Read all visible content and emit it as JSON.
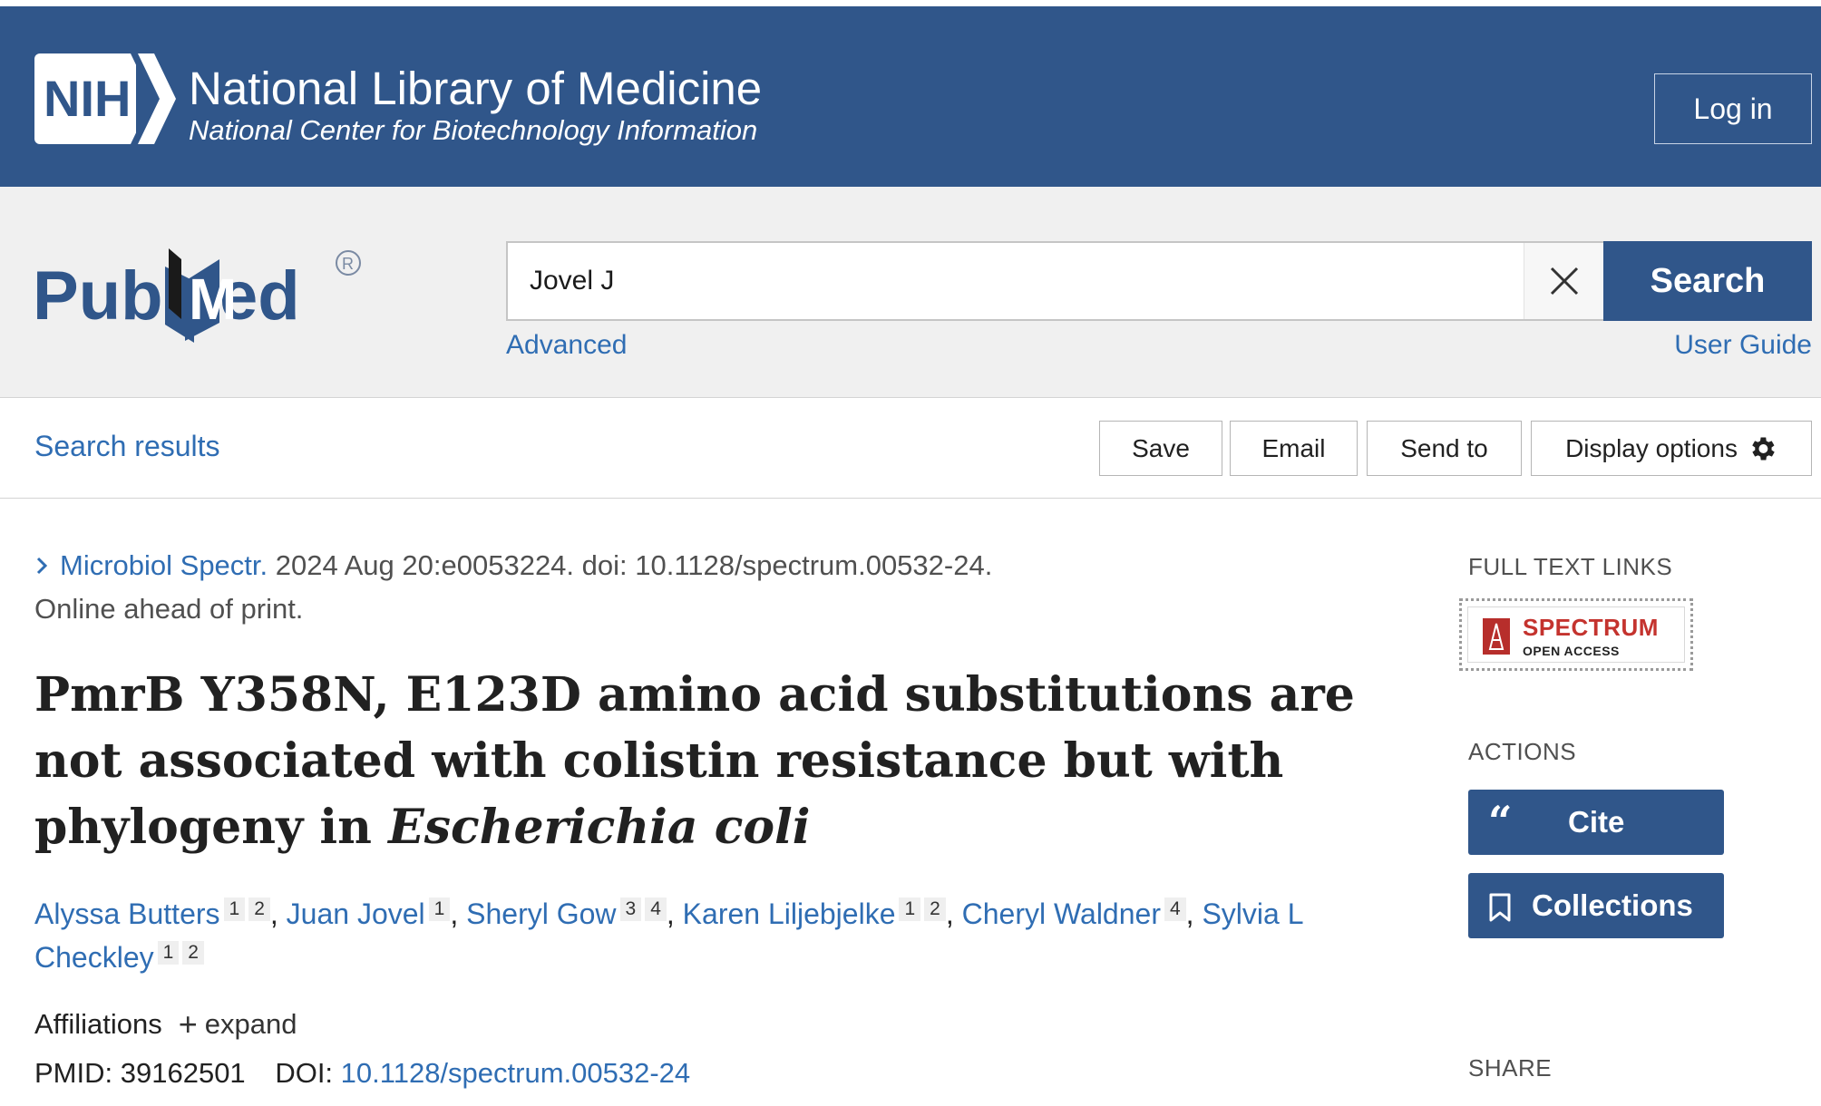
{
  "nih": {
    "logo_text": "NIH",
    "title": "National Library of Medicine",
    "subtitle": "National Center for Biotechnology Information",
    "login_label": "Log in"
  },
  "pubmed": {
    "logo_text": "PubMed",
    "search_value": "Jovel J",
    "search_button": "Search",
    "advanced_link": "Advanced",
    "user_guide_link": "User Guide"
  },
  "toolbar": {
    "search_results_link": "Search results",
    "save_label": "Save",
    "email_label": "Email",
    "send_to_label": "Send to",
    "display_options_label": "Display options"
  },
  "article": {
    "journal": "Microbiol Spectr.",
    "citation": "2024 Aug 20:e0053224. doi: 10.1128/spectrum.00532-24.",
    "print_status": "Online ahead of print.",
    "title_main": "PmrB Y358N, E123D amino acid substitutions are not associated with colistin resistance but with phylogeny in",
    "title_italic": "Escherichia coli",
    "authors": [
      {
        "name": "Alyssa Butters",
        "affiliations": [
          "1",
          "2"
        ]
      },
      {
        "name": "Juan Jovel",
        "affiliations": [
          "1"
        ]
      },
      {
        "name": "Sheryl Gow",
        "affiliations": [
          "3",
          "4"
        ]
      },
      {
        "name": "Karen Liljebjelke",
        "affiliations": [
          "1",
          "2"
        ]
      },
      {
        "name": "Cheryl Waldner",
        "affiliations": [
          "4"
        ]
      },
      {
        "name": "Sylvia L Checkley",
        "affiliations": [
          "1",
          "2"
        ]
      }
    ],
    "affiliations_label": "Affiliations",
    "expand_label": "expand",
    "pmid_label": "PMID:",
    "pmid": "39162501",
    "doi_label": "DOI:",
    "doi": "10.1128/spectrum.00532-24"
  },
  "sidebar": {
    "full_text_links_heading": "FULL TEXT LINKS",
    "spectrum_name": "SPECTRUM",
    "spectrum_sub": "OPEN ACCESS",
    "actions_heading": "ACTIONS",
    "cite_label": "Cite",
    "collections_label": "Collections",
    "share_heading": "SHARE"
  },
  "colors": {
    "nih_blue": "#30568a",
    "link_blue": "#2f6db3",
    "spectrum_red": "#c4332e"
  }
}
